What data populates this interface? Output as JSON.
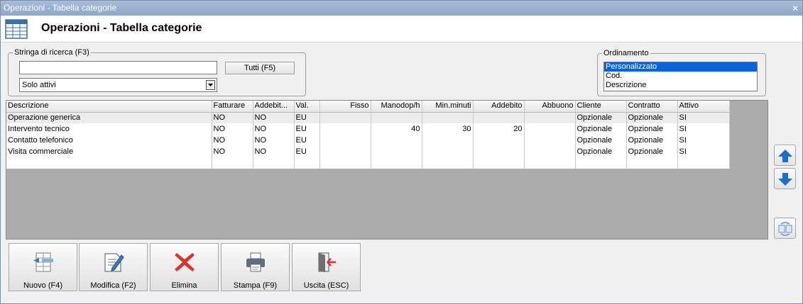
{
  "window": {
    "title": "Operazioni - Tabella categorie",
    "close": "×"
  },
  "header": {
    "title": "Operazioni - Tabella categorie"
  },
  "search": {
    "group_label": "Stringa di ricerca (F3)",
    "value": "",
    "all_button": "Tutti (F5)",
    "filter_selected": "Solo attivi"
  },
  "ordering": {
    "group_label": "Ordinamento",
    "options": [
      "Personalizzato",
      "Cod.",
      "Descrizione"
    ],
    "selected_index": 0
  },
  "table": {
    "columns": [
      "Descrizione",
      "Fatturare",
      "Addebit...",
      "Val.",
      "Fisso",
      "Manodop/h",
      "Min.minuti",
      "Addebito",
      "Abbuono",
      "Cliente",
      "Contratto",
      "Attivo"
    ],
    "rows": [
      [
        "Operazione generica",
        "NO",
        "NO",
        "EU",
        "",
        "",
        "",
        "",
        "",
        "Opzionale",
        "Opzionale",
        "SI"
      ],
      [
        "Intervento tecnico",
        "NO",
        "NO",
        "EU",
        "",
        "40",
        "30",
        "20",
        "",
        "Opzionale",
        "Opzionale",
        "SI"
      ],
      [
        "Contatto telefonico",
        "NO",
        "NO",
        "EU",
        "",
        "",
        "",
        "",
        "",
        "Opzionale",
        "Opzionale",
        "SI"
      ],
      [
        "Visita commerciale",
        "NO",
        "NO",
        "EU",
        "",
        "",
        "",
        "",
        "",
        "Opzionale",
        "Opzionale",
        "SI"
      ]
    ]
  },
  "toolbar": {
    "new_label": "Nuovo (F4)",
    "edit_label": "Modifica (F2)",
    "delete_label": "Elimina",
    "print_label": "Stampa (F9)",
    "exit_label": "Uscita (ESC)"
  },
  "colors": {
    "titlebar": "#95abc9",
    "selection": "#0a64d8",
    "arrow_blue": "#1f6ec7",
    "delete_red": "#d9342b",
    "grid_background": "#ababab"
  },
  "icons": {
    "header": "table-grid-icon",
    "move_up": "arrow-up-icon",
    "move_down": "arrow-down-icon",
    "swap": "swap-icon",
    "new": "new-record-icon",
    "edit": "edit-pencil-icon",
    "delete": "delete-x-icon",
    "print": "printer-icon",
    "exit": "exit-door-icon"
  }
}
